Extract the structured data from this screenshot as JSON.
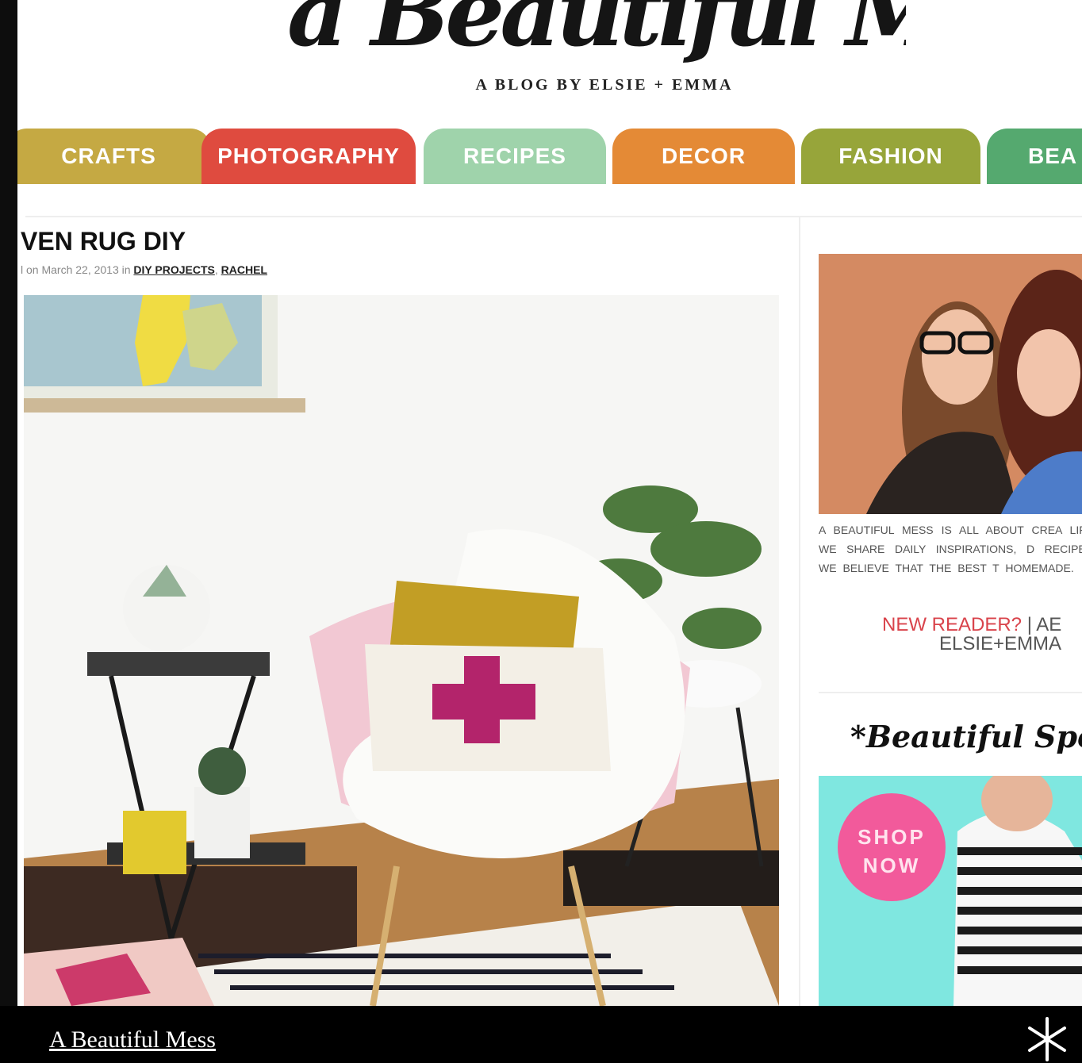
{
  "header": {
    "logo_text": "a Beautiful Mess",
    "tagline": "A BLOG BY ELSIE + EMMA"
  },
  "nav": {
    "tabs": [
      {
        "label": "CRAFTS",
        "color": "#c5a943"
      },
      {
        "label": "PHOTOGRAPHY",
        "color": "#df4b3f"
      },
      {
        "label": "RECIPES",
        "color": "#9fd3ab"
      },
      {
        "label": "DECOR",
        "color": "#e48a36"
      },
      {
        "label": "FASHION",
        "color": "#97a53a"
      },
      {
        "label": "BEA",
        "color": "#55a96f"
      }
    ]
  },
  "post": {
    "title": "VEN RUG DIY",
    "meta_prefix": "l on March 22, 2013 in",
    "categories": [
      "DIY PROJECTS",
      "RACHEL"
    ],
    "image_icon": "chair-pillow-photo"
  },
  "sidebar": {
    "bio": "A BEAUTIFUL MESS IS ALL ABOUT CREA LIFE. WE SHARE DAILY INSPIRATIONS, D RECIPES. WE BELIEVE THAT THE BEST T HOMEMADE.",
    "new_reader": "NEW READER?",
    "separator": "|",
    "about_partial": "AE",
    "elsie_emma": "ELSIE+EMMA",
    "sponsors_title": "*Beautiful Spons",
    "ad_badge_line1": "SHOP",
    "ad_badge_line2": "NOW"
  },
  "footer": {
    "link": "A Beautiful Mess",
    "icon": "starburst-icon"
  }
}
